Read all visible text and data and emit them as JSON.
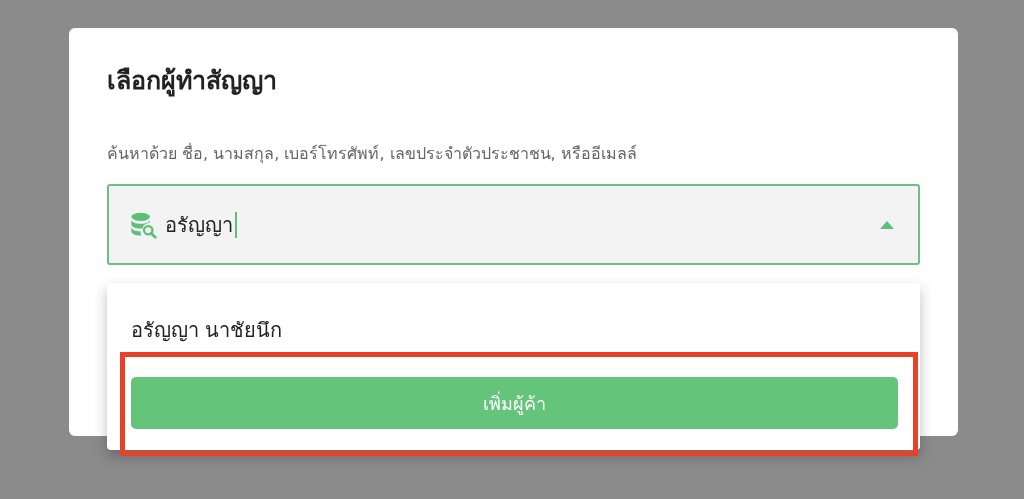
{
  "dialog": {
    "title": "เลือกผู้ทำสัญญา",
    "search_label": "ค้นหาด้วย ชื่อ, นามสกุล, เบอร์โทรศัพท์, เลขประจำตัวประชาชน, หรืออีเมลล์",
    "search_field": {
      "value": "อรัญญา",
      "expanded": true
    },
    "options": [
      {
        "name": "อรัญญา นาชัยนึก"
      }
    ],
    "add_button": "เพิ่มผู้ค้า"
  }
}
